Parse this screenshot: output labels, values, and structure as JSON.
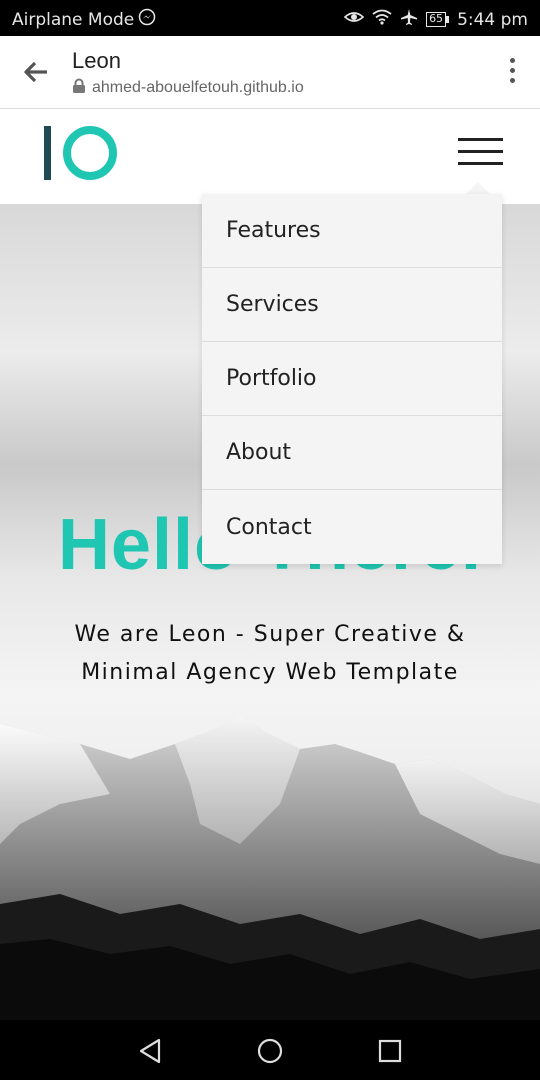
{
  "status_bar": {
    "left_text": "Airplane Mode",
    "time": "5:44 pm",
    "battery": "65",
    "icons": [
      "messenger-icon",
      "eye-icon",
      "wifi-icon",
      "airplane-icon",
      "battery-icon"
    ]
  },
  "browser": {
    "page_title": "Leon",
    "url": "ahmed-abouelfetouh.github.io",
    "icons": [
      "back-arrow-icon",
      "lock-icon",
      "more-vert-icon"
    ]
  },
  "site": {
    "logo_alt": "IO",
    "accent_color": "#1fc6b1",
    "dark_color": "#1e4b52"
  },
  "menu": {
    "items": [
      "Features",
      "Services",
      "Portfolio",
      "About",
      "Contact"
    ]
  },
  "hero": {
    "title": "Hello There.",
    "subtitle": "We are Leon - Super Creative & Minimal Agency Web Template"
  },
  "nav": {
    "icons": [
      "nav-back-icon",
      "nav-home-icon",
      "nav-recents-icon"
    ]
  }
}
